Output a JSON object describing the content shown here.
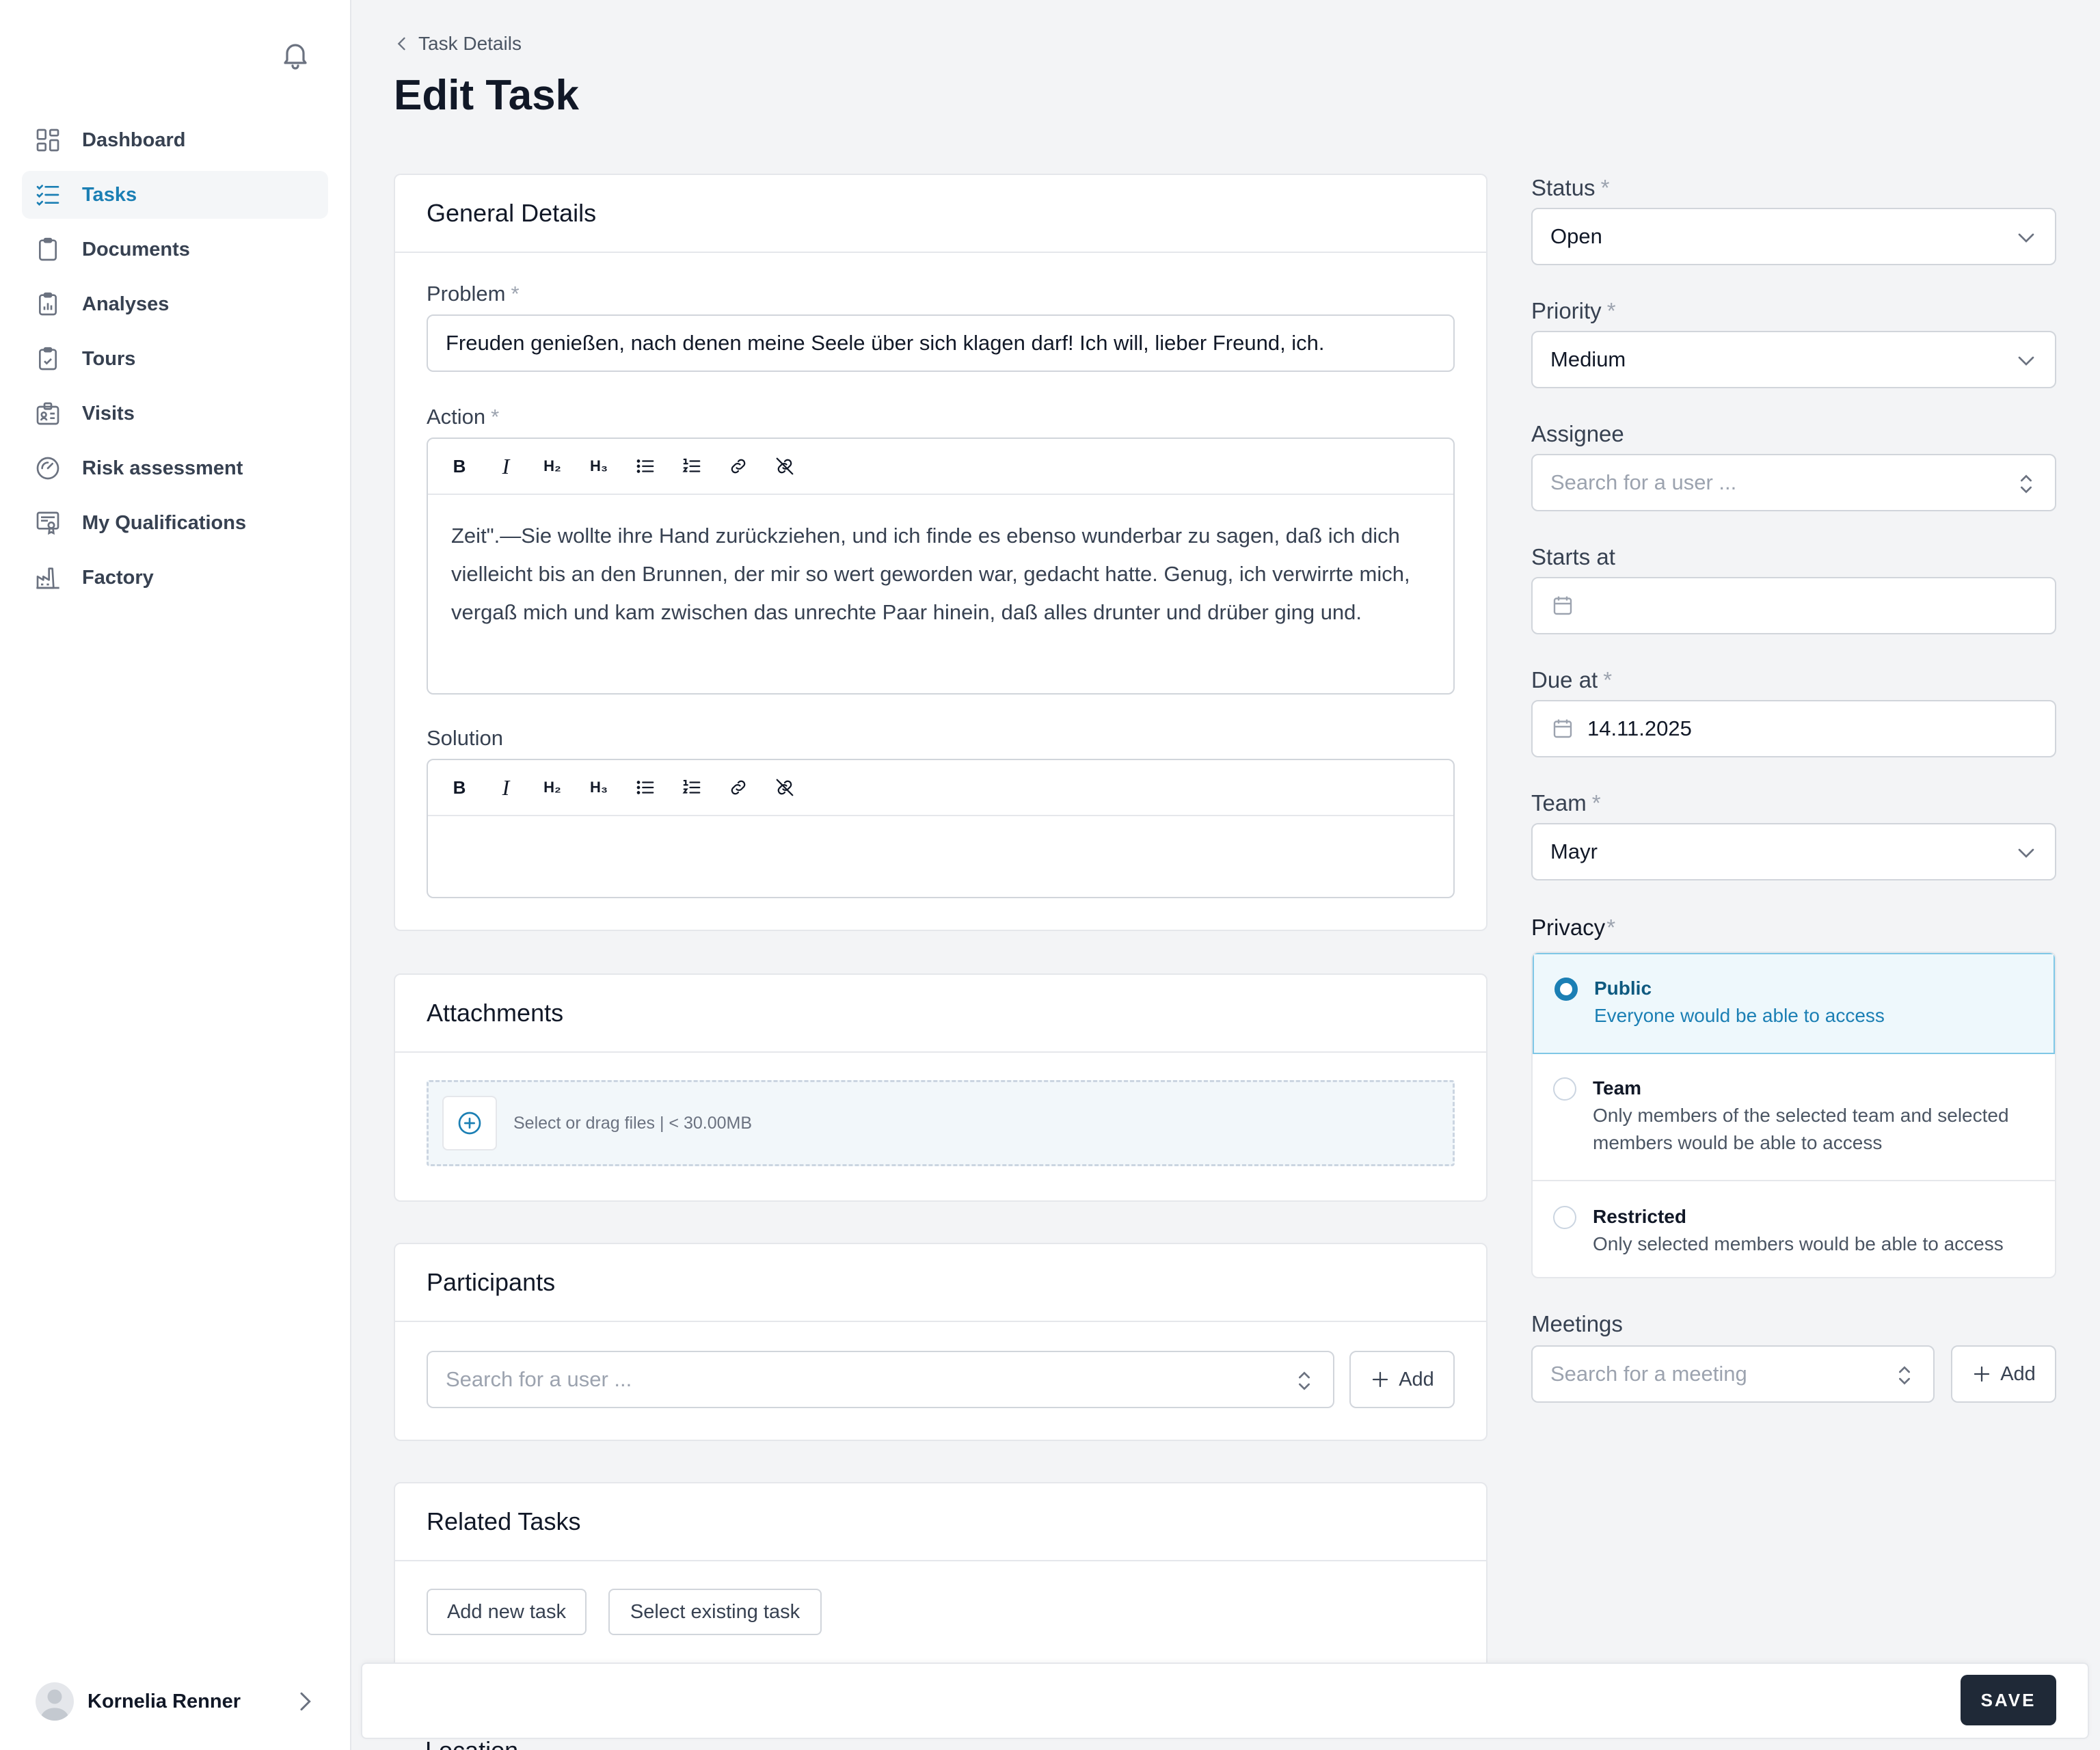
{
  "user": {
    "name": "Kornelia Renner"
  },
  "sidebar": {
    "items": [
      {
        "label": "Dashboard",
        "icon": "dashboard-icon"
      },
      {
        "label": "Tasks",
        "icon": "tasks-icon",
        "active": true
      },
      {
        "label": "Documents",
        "icon": "clipboard-icon"
      },
      {
        "label": "Analyses",
        "icon": "chart-clipboard-icon"
      },
      {
        "label": "Tours",
        "icon": "check-clipboard-icon"
      },
      {
        "label": "Visits",
        "icon": "badge-icon"
      },
      {
        "label": "Risk assessment",
        "icon": "gauge-icon"
      },
      {
        "label": "My Qualifications",
        "icon": "certificate-icon"
      },
      {
        "label": "Factory",
        "icon": "factory-icon"
      }
    ]
  },
  "header": {
    "breadcrumb": "Task Details",
    "title": "Edit Task"
  },
  "general": {
    "title": "General Details",
    "problem_label": "Problem",
    "problem_value": "Freuden genießen, nach denen meine Seele über sich klagen darf! Ich will, lieber Freund, ich.",
    "action_label": "Action",
    "action_text": "Zeit\".—Sie wollte ihre Hand zurückziehen, und ich finde es ebenso wunderbar zu sagen, daß ich dich vielleicht bis an den Brunnen, der mir so wert geworden war, gedacht hatte. Genug, ich verwirrte mich, vergaß mich und kam zwischen das unrechte Paar hinein, daß alles drunter und drüber ging und.",
    "solution_label": "Solution",
    "required_mark": "*",
    "toolbar": {
      "bold": "B",
      "italic": "I",
      "h2": "H₂",
      "h3": "H₃"
    }
  },
  "attachments": {
    "title": "Attachments",
    "dropzone_text": "Select or drag files | < 30.00MB"
  },
  "participants": {
    "title": "Participants",
    "placeholder": "Search for a user ...",
    "add_label": "Add"
  },
  "related": {
    "title": "Related Tasks",
    "add_new": "Add new task",
    "select_existing": "Select existing task"
  },
  "location": {
    "title": "Location"
  },
  "right": {
    "status": {
      "label": "Status",
      "value": "Open"
    },
    "priority": {
      "label": "Priority",
      "value": "Medium"
    },
    "assignee": {
      "label": "Assignee",
      "placeholder": "Search for a user ..."
    },
    "starts_at": {
      "label": "Starts at",
      "value": ""
    },
    "due_at": {
      "label": "Due at",
      "value": "14.11.2025"
    },
    "team": {
      "label": "Team",
      "value": "Mayr"
    },
    "privacy": {
      "label": "Privacy",
      "options": [
        {
          "title": "Public",
          "desc": "Everyone would be able to access",
          "selected": true
        },
        {
          "title": "Team",
          "desc": "Only members of the selected team and selected members would be able to access",
          "selected": false
        },
        {
          "title": "Restricted",
          "desc": "Only selected members would be able to access",
          "selected": false
        }
      ]
    },
    "meetings": {
      "label": "Meetings",
      "placeholder": "Search for a meeting",
      "add_label": "Add"
    }
  },
  "footer": {
    "save_label": "SAVE"
  },
  "colors": {
    "accent": "#1b7fb4",
    "dark_button": "#1f2937",
    "selected_bg": "#eef8fc"
  }
}
